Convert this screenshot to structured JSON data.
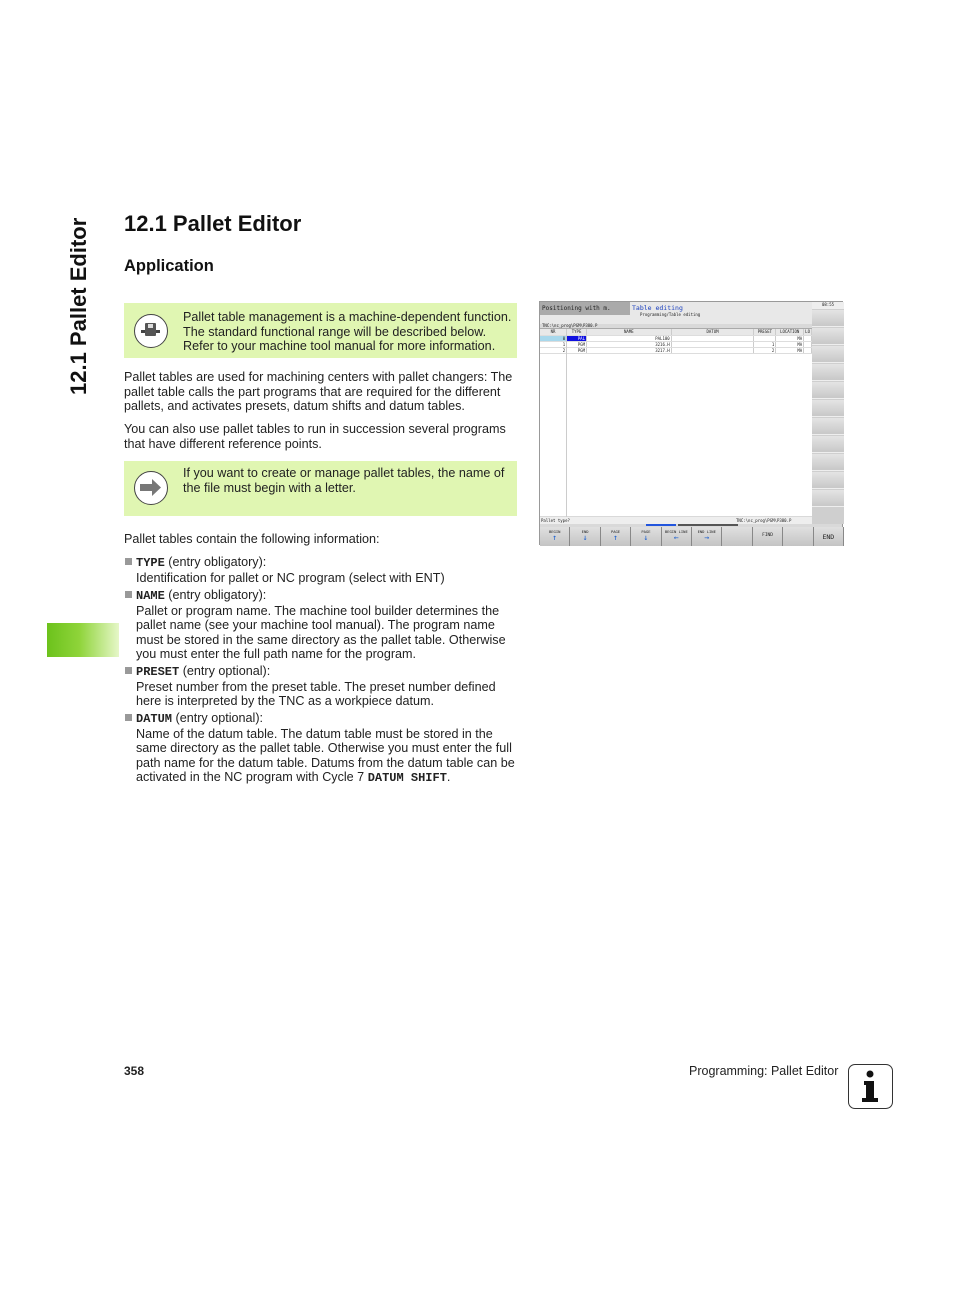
{
  "sidebar": {
    "title": "12.1 Pallet Editor"
  },
  "heading": "12.1 Pallet Editor",
  "subheading": "Application",
  "note1": {
    "icon": "machine-dependent-icon",
    "text": "Pallet table management is a machine-dependent function. The standard functional range will be described below. Refer to your machine tool manual for more information."
  },
  "para1": "Pallet tables are used for machining centers with pallet changers: The pallet table calls the part programs that are required for the different pallets, and activates presets, datum shifts and datum tables.",
  "para2": "You can also use pallet tables to run in succession several programs that have different reference points.",
  "note2": {
    "icon": "arrow-right-icon",
    "text": "If you want to create or manage pallet tables, the name of the file must begin with a letter."
  },
  "para3": "Pallet tables contain the following information:",
  "items": [
    {
      "key": "TYPE",
      "qual": " (entry obligatory):",
      "body": "Identification for pallet or NC program (select with ENT)"
    },
    {
      "key": "NAME",
      "qual": " (entry obligatory):",
      "body": "Pallet or program name. The machine tool builder determines the pallet name (see your machine tool manual). The program name must be stored in the same directory as the pallet table. Otherwise you must enter the full path name for the program."
    },
    {
      "key": "PRESET",
      "qual": " (entry optional):",
      "body": "Preset number from the preset table. The preset number defined here is interpreted by the TNC as a workpiece datum."
    },
    {
      "key": "DATUM",
      "qual": " (entry optional):",
      "body_pre": "Name of the datum table. The datum table must be stored in the same directory as the pallet table. Otherwise you must enter the full path name for the datum table. Datums from the datum table can be activated in the NC program with Cycle 7 ",
      "body_code": "DATUM SHIFT",
      "body_post": "."
    }
  ],
  "screen": {
    "mode1": "Positioning with m.",
    "mode2": "Table editing",
    "mode2_sub": "Programming/Table editing",
    "clock": "08:55",
    "path": "TNC:\\nc_prog\\PGM\\P380.P",
    "columns": [
      "NR",
      "TYPE",
      "NAME",
      "DATUM",
      "PRESET",
      "LOCATION",
      "LO"
    ],
    "rows": [
      [
        "0",
        "PAL",
        "PAL100",
        "",
        "",
        "MA",
        ""
      ],
      [
        "1",
        "PGM",
        "3216.H",
        "",
        "1",
        "MA",
        ""
      ],
      [
        "2",
        "PGM",
        "3217.H",
        "",
        "2",
        "MA",
        ""
      ]
    ],
    "status_left": "Pallet type?",
    "status_right": "TNC:\\nc_prog\\PGM\\P380.P",
    "softkeys": [
      "BEGIN",
      "END",
      "PAGE",
      "PAGE",
      "BEGIN LINE",
      "END LINE",
      "",
      "FIND",
      "",
      "END"
    ]
  },
  "footer": {
    "page": "358",
    "chapter": "Programming: Pallet Editor",
    "icon": "info-icon"
  },
  "colors": {
    "note_bg": "#e0f6b2",
    "tab_green": "#6cc21c",
    "accent_blue": "#1a3fbf"
  }
}
